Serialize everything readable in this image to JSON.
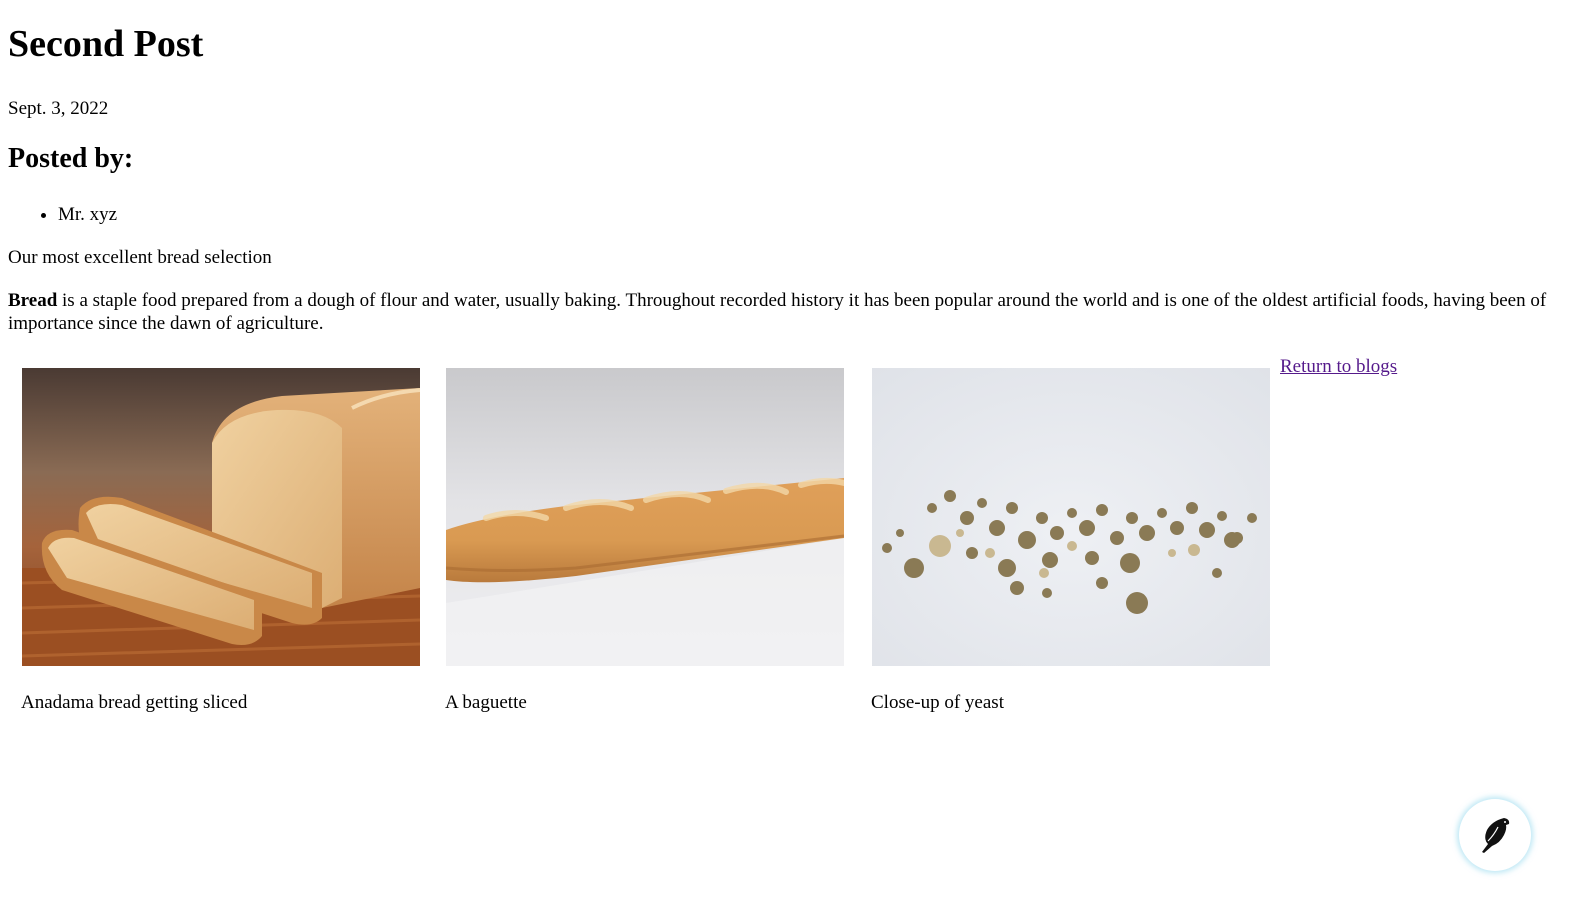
{
  "post": {
    "title": "Second Post",
    "date": "Sept. 3, 2022",
    "posted_by_heading": "Posted by:",
    "authors": [
      "Mr. xyz"
    ],
    "tagline": "Our most excellent bread selection",
    "body_bold": "Bread",
    "body_rest": " is a staple food prepared from a dough of flour and water, usually baking. Throughout recorded history it has been popular around the world and is one of the oldest artificial foods, having been of importance since the dawn of agriculture."
  },
  "gallery": [
    {
      "caption": "Anadama bread getting sliced",
      "icon": "bread-loaf-photo"
    },
    {
      "caption": "A baguette",
      "icon": "baguette-photo"
    },
    {
      "caption": "Close-up of yeast",
      "icon": "yeast-photo"
    }
  ],
  "nav": {
    "return_label": "Return to blogs"
  },
  "widget": {
    "icon": "bird-logo-icon"
  },
  "colors": {
    "link_visited": "#551a8b",
    "fab_glow": "#82d2eb"
  }
}
